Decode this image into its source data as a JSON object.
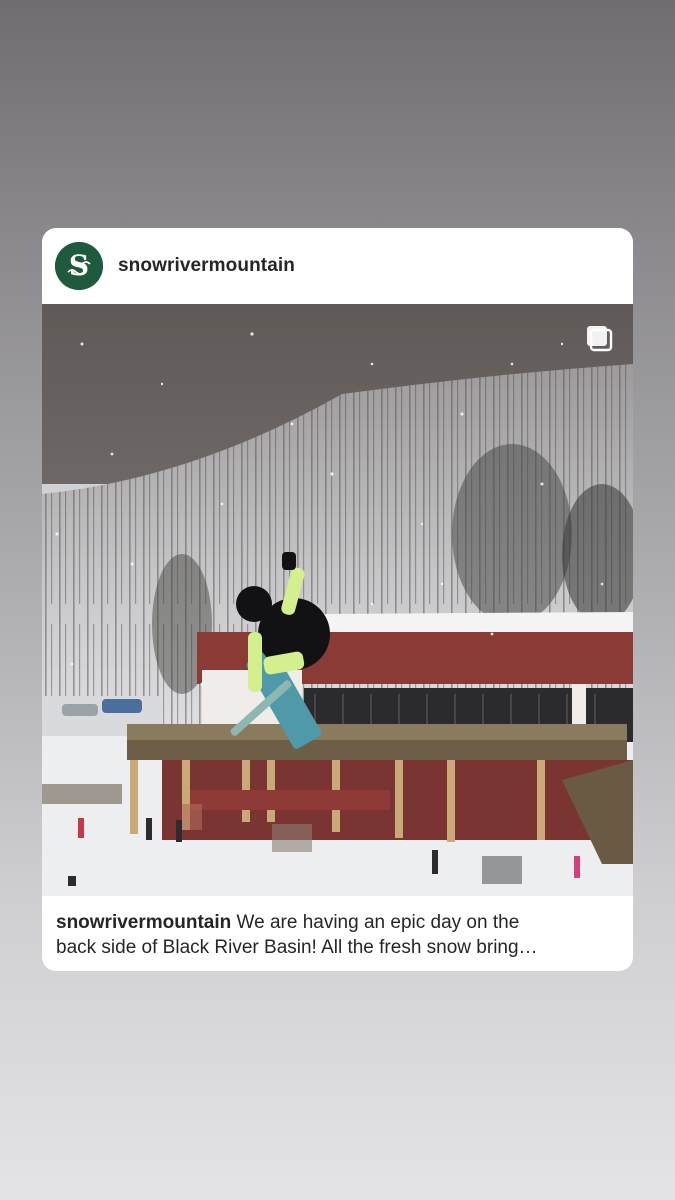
{
  "post": {
    "username": "snowrivermountain",
    "avatar_letter": "S",
    "caption_user": "snowrivermountain",
    "caption_line1": " We are having an epic day on the",
    "caption_line2": "back side of Black River Basin!  All the fresh snow bring…",
    "image_icon": "multiple-images-icon"
  },
  "colors": {
    "avatar_bg": "#1f5a3e",
    "lodge_roof": "#8a3b36"
  }
}
